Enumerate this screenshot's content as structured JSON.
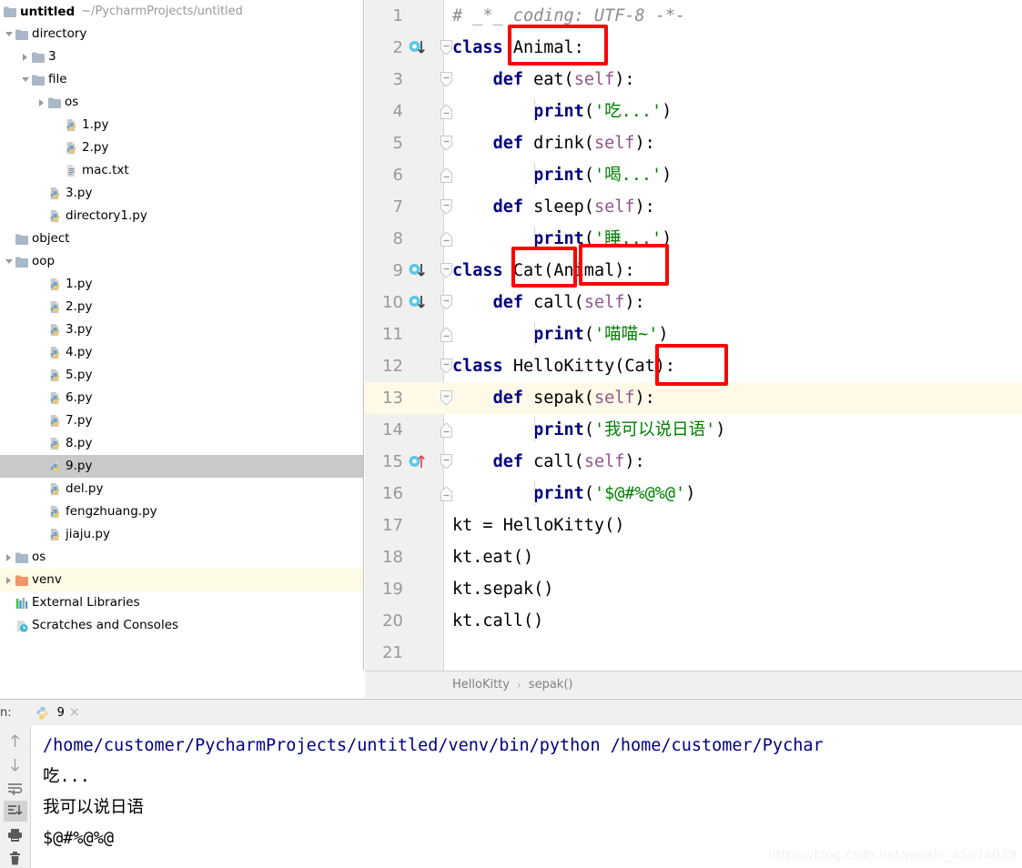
{
  "project": {
    "name": "untitled",
    "path": "~/PycharmProjects/untitled",
    "tree": [
      {
        "label": "directory",
        "indent": 0,
        "twisty": "open",
        "icon": "folder-icon",
        "state": "normal"
      },
      {
        "label": "3",
        "indent": 1,
        "twisty": "closed",
        "icon": "folder-icon",
        "state": "normal"
      },
      {
        "label": "file",
        "indent": 1,
        "twisty": "open",
        "icon": "folder-icon",
        "state": "normal"
      },
      {
        "label": "os",
        "indent": 2,
        "twisty": "closed",
        "icon": "folder-icon",
        "state": "normal"
      },
      {
        "label": "1.py",
        "indent": 3,
        "twisty": "none",
        "icon": "python-file-icon",
        "state": "normal"
      },
      {
        "label": "2.py",
        "indent": 3,
        "twisty": "none",
        "icon": "python-file-icon",
        "state": "normal"
      },
      {
        "label": "mac.txt",
        "indent": 3,
        "twisty": "none",
        "icon": "text-file-icon",
        "state": "normal"
      },
      {
        "label": "3.py",
        "indent": 2,
        "twisty": "none",
        "icon": "python-file-icon",
        "state": "normal"
      },
      {
        "label": "directory1.py",
        "indent": 2,
        "twisty": "none",
        "icon": "python-file-icon",
        "state": "normal"
      },
      {
        "label": "object",
        "indent": 0,
        "twisty": "none",
        "icon": "folder-icon",
        "state": "normal"
      },
      {
        "label": "oop",
        "indent": 0,
        "twisty": "open",
        "icon": "folder-icon",
        "state": "normal"
      },
      {
        "label": "1.py",
        "indent": 2,
        "twisty": "none",
        "icon": "python-file-icon",
        "state": "normal"
      },
      {
        "label": "2.py",
        "indent": 2,
        "twisty": "none",
        "icon": "python-file-icon",
        "state": "normal"
      },
      {
        "label": "3.py",
        "indent": 2,
        "twisty": "none",
        "icon": "python-file-icon",
        "state": "normal"
      },
      {
        "label": "4.py",
        "indent": 2,
        "twisty": "none",
        "icon": "python-file-icon",
        "state": "normal"
      },
      {
        "label": "5.py",
        "indent": 2,
        "twisty": "none",
        "icon": "python-file-icon",
        "state": "normal"
      },
      {
        "label": "6.py",
        "indent": 2,
        "twisty": "none",
        "icon": "python-file-icon",
        "state": "normal"
      },
      {
        "label": "7.py",
        "indent": 2,
        "twisty": "none",
        "icon": "python-file-icon",
        "state": "normal"
      },
      {
        "label": "8.py",
        "indent": 2,
        "twisty": "none",
        "icon": "python-file-icon",
        "state": "normal"
      },
      {
        "label": "9.py",
        "indent": 2,
        "twisty": "none",
        "icon": "python-file-icon",
        "state": "selected"
      },
      {
        "label": "del.py",
        "indent": 2,
        "twisty": "none",
        "icon": "python-file-icon",
        "state": "normal"
      },
      {
        "label": "fengzhuang.py",
        "indent": 2,
        "twisty": "none",
        "icon": "python-file-icon",
        "state": "normal"
      },
      {
        "label": "jiaju.py",
        "indent": 2,
        "twisty": "none",
        "icon": "python-file-icon",
        "state": "normal"
      },
      {
        "label": "os",
        "indent": 0,
        "twisty": "closed",
        "icon": "folder-icon",
        "state": "normal"
      },
      {
        "label": "venv",
        "indent": 0,
        "twisty": "closed",
        "icon": "folder-orange-icon",
        "state": "cream"
      },
      {
        "label": "External Libraries",
        "indent": 0,
        "twisty": "none",
        "icon": "libraries-icon",
        "state": "normal"
      },
      {
        "label": "Scratches and Consoles",
        "indent": 0,
        "twisty": "none",
        "icon": "scratches-icon",
        "state": "normal"
      }
    ]
  },
  "editor": {
    "lines": [
      {
        "n": "1",
        "marker": "none",
        "fold": "none",
        "current": false
      },
      {
        "n": "2",
        "marker": "impl-down",
        "fold": "start",
        "current": false
      },
      {
        "n": "3",
        "marker": "none",
        "fold": "start",
        "current": false
      },
      {
        "n": "4",
        "marker": "none",
        "fold": "end",
        "current": false
      },
      {
        "n": "5",
        "marker": "none",
        "fold": "start",
        "current": false
      },
      {
        "n": "6",
        "marker": "none",
        "fold": "end",
        "current": false
      },
      {
        "n": "7",
        "marker": "none",
        "fold": "start",
        "current": false
      },
      {
        "n": "8",
        "marker": "none",
        "fold": "end",
        "current": false
      },
      {
        "n": "9",
        "marker": "impl-down",
        "fold": "start",
        "current": false
      },
      {
        "n": "10",
        "marker": "impl-down",
        "fold": "start",
        "current": false
      },
      {
        "n": "11",
        "marker": "none",
        "fold": "end",
        "current": false
      },
      {
        "n": "12",
        "marker": "none",
        "fold": "start",
        "current": false
      },
      {
        "n": "13",
        "marker": "none",
        "fold": "start",
        "current": true
      },
      {
        "n": "14",
        "marker": "none",
        "fold": "end",
        "current": false
      },
      {
        "n": "15",
        "marker": "override-up",
        "fold": "start",
        "current": false
      },
      {
        "n": "16",
        "marker": "none",
        "fold": "end",
        "current": false
      },
      {
        "n": "17",
        "marker": "none",
        "fold": "none",
        "current": false
      },
      {
        "n": "18",
        "marker": "none",
        "fold": "none",
        "current": false
      },
      {
        "n": "19",
        "marker": "none",
        "fold": "none",
        "current": false
      },
      {
        "n": "20",
        "marker": "none",
        "fold": "none",
        "current": false
      },
      {
        "n": "21",
        "marker": "none",
        "fold": "none",
        "current": false
      }
    ],
    "code": [
      "# _*_ coding: UTF-8 -*-",
      "class Animal:",
      "    def eat(self):",
      "        print('吃...')",
      "    def drink(self):",
      "        print('喝...')",
      "    def sleep(self):",
      "        print('睡...')",
      "class Cat(Animal):",
      "    def call(self):",
      "        print('喵喵~')",
      "class HelloKitty(Cat):",
      "    def sepak(self):",
      "        print('我可以说日语')",
      "    def call(self):",
      "        print('$@#%@%@')",
      "kt = HelloKitty()",
      "kt.eat()",
      "kt.sepak()",
      "kt.call()",
      ""
    ],
    "annotations": [
      {
        "label": "Animal",
        "line": 2
      },
      {
        "label": "Cat",
        "line": 9
      },
      {
        "label": "Animal)",
        "line": 9
      },
      {
        "label": "(Cat)",
        "line": 12
      }
    ],
    "annotation_color": "#ff0000",
    "breadcrumb": [
      "HelloKitty",
      "sepak()"
    ],
    "breadcrumb_separator": "›"
  },
  "run_panel": {
    "panel_label": "n:",
    "tab_name": "9",
    "close_label": "×",
    "toolbar": [
      {
        "name": "up-arrow-icon",
        "active": false
      },
      {
        "name": "down-arrow-icon",
        "active": false
      },
      {
        "name": "soft-wrap-icon",
        "active": false
      },
      {
        "name": "scroll-to-end-icon",
        "active": true
      },
      {
        "name": "print-icon",
        "active": false
      },
      {
        "name": "trash-icon",
        "active": false
      }
    ],
    "console_lines": [
      {
        "text": "/home/customer/PycharmProjects/untitled/venv/bin/python /home/customer/Pychar",
        "type": "command"
      },
      {
        "text": "吃...",
        "type": "output"
      },
      {
        "text": "我可以说日语",
        "type": "output"
      },
      {
        "text": "$@#%@%@",
        "type": "output"
      }
    ]
  },
  "watermark": "https://blog.csdn.net/weixin_45674039",
  "colors": {
    "keyword": "#000080",
    "string": "#008000",
    "comment": "#8c8c8c",
    "self": "#94558d",
    "annotation": "#ff0000",
    "current_line": "#fffae7",
    "selection": "#c9c9c9",
    "gutter": "#f0f0f0"
  }
}
